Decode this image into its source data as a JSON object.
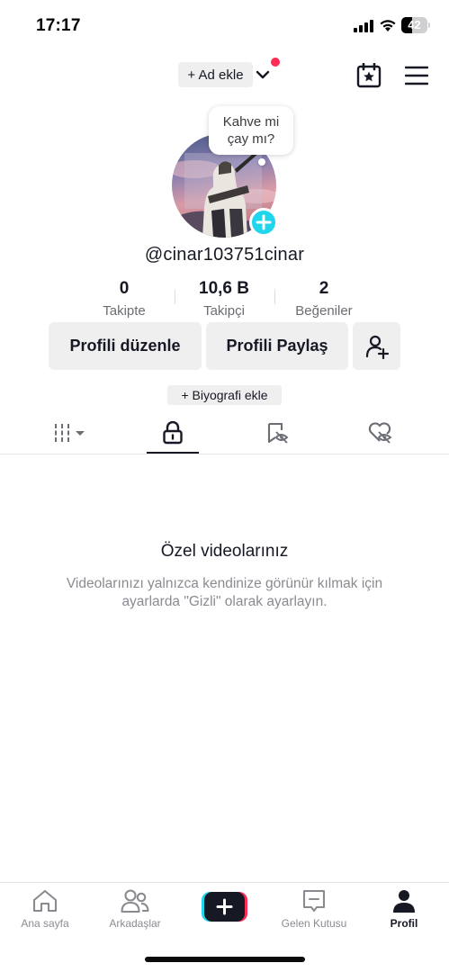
{
  "status_bar": {
    "time": "17:17",
    "battery": "42",
    "battery_level": 0.42
  },
  "header": {
    "add_name_label": "+ Ad ekle",
    "has_notification": true
  },
  "profile": {
    "bubble_text_line1": "Kahve mi",
    "bubble_text_line2": "çay mı?",
    "username": "@cinar103751cinar",
    "stats": [
      {
        "value": "0",
        "label": "Takipte"
      },
      {
        "value": "10,6 B",
        "label": "Takipçi"
      },
      {
        "value": "2",
        "label": "Beğeniler"
      }
    ],
    "edit_profile_label": "Profili düzenle",
    "share_profile_label": "Profili Paylaş",
    "add_bio_label": "+ Biyografi ekle"
  },
  "tabs": [
    {
      "name": "videos-grid",
      "icon": "grid-bars-icon",
      "active": false
    },
    {
      "name": "private",
      "icon": "lock-icon",
      "active": true
    },
    {
      "name": "saved",
      "icon": "bookmark-hidden-icon",
      "active": false
    },
    {
      "name": "liked",
      "icon": "heart-hidden-icon",
      "active": false
    }
  ],
  "empty_state": {
    "title": "Özel videolarınız",
    "description": "Videolarınızı yalnızca kendinize görünür kılmak için ayarlarda \"Gizli\" olarak ayarlayın."
  },
  "bottom_nav": [
    {
      "label": "Ana sayfa",
      "icon": "home-icon",
      "active": false
    },
    {
      "label": "Arkadaşlar",
      "icon": "friends-icon",
      "active": false
    },
    {
      "label": "",
      "icon": "create-plus-icon",
      "active": false
    },
    {
      "label": "Gelen Kutusu",
      "icon": "inbox-icon",
      "active": false
    },
    {
      "label": "Profil",
      "icon": "profile-icon",
      "active": true
    }
  ],
  "colors": {
    "accent_teal": "#20d5ec",
    "accent_red": "#fe2c55",
    "text_primary": "#161823",
    "text_secondary": "#8a8b91"
  }
}
